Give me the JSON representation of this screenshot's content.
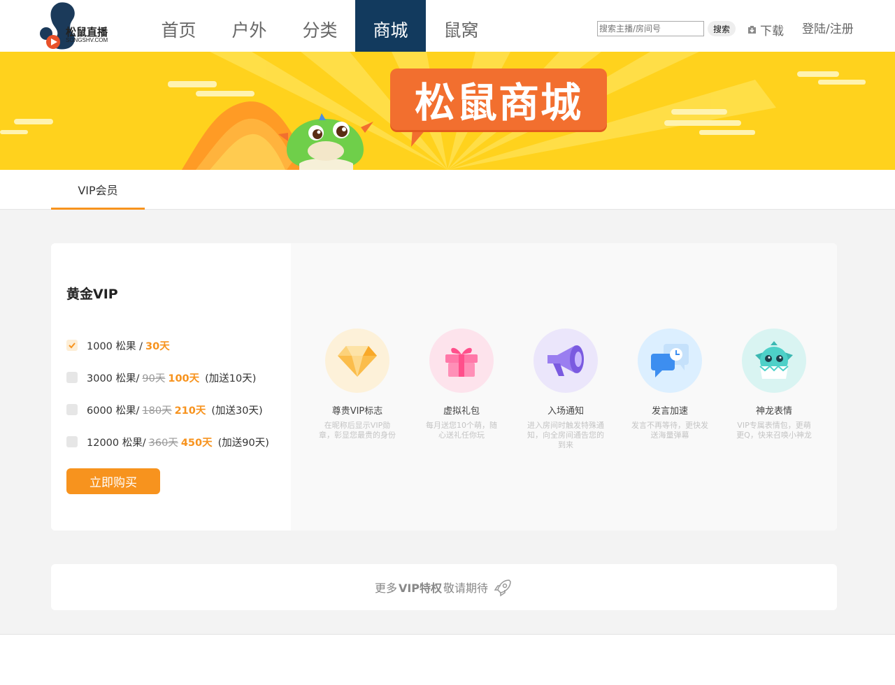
{
  "header": {
    "logo_text": "松鼠直播",
    "logo_sub": "SONGSHV.COM",
    "nav": [
      "首页",
      "户外",
      "分类",
      "商城",
      "鼠窝"
    ],
    "active_nav": "商城",
    "search_placeholder": "搜索主播/房间号",
    "search_button": "搜索",
    "download": "下载",
    "login": "登陆/注册"
  },
  "banner": {
    "title": "松鼠商城"
  },
  "tabs": {
    "active": "VIP会员"
  },
  "vip": {
    "title": "黄金VIP",
    "options": [
      {
        "price": "1000 松果 /",
        "old_days": "",
        "days": "30天",
        "bonus": "",
        "checked": true
      },
      {
        "price": "3000 松果/",
        "old_days": "90天",
        "days": "100天",
        "bonus": "(加送10天)",
        "checked": false
      },
      {
        "price": "6000 松果/",
        "old_days": "180天",
        "days": "210天",
        "bonus": "(加送30天)",
        "checked": false
      },
      {
        "price": "12000 松果/",
        "old_days": "360天",
        "days": "450天",
        "bonus": "(加送90天)",
        "checked": false
      }
    ],
    "buy_button": "立即购买"
  },
  "benefits": [
    {
      "icon": "diamond-icon",
      "title": "尊贵VIP标志",
      "desc": "在昵称后显示VIP勋章，彰显您最贵的身份",
      "color": "#fdf1d9"
    },
    {
      "icon": "gift-icon",
      "title": "虚拟礼包",
      "desc": "每月送您10个萌，随心送礼任你玩",
      "color": "#fde3ec"
    },
    {
      "icon": "megaphone-icon",
      "title": "入场通知",
      "desc": "进入房间时触发特殊通知，向全房间通告您的到来",
      "color": "#ebe6fb"
    },
    {
      "icon": "chat-clock-icon",
      "title": "发言加速",
      "desc": "发言不再等待，更快发送海量弹幕",
      "color": "#dcefff"
    },
    {
      "icon": "dragon-icon",
      "title": "神龙表情",
      "desc": "VIP专属表情包，更萌更Q，快来召唤小神龙",
      "color": "#d9f4f2"
    }
  ],
  "more": {
    "prefix": "更多",
    "highlight": "VIP特权",
    "suffix": "敬请期待"
  }
}
